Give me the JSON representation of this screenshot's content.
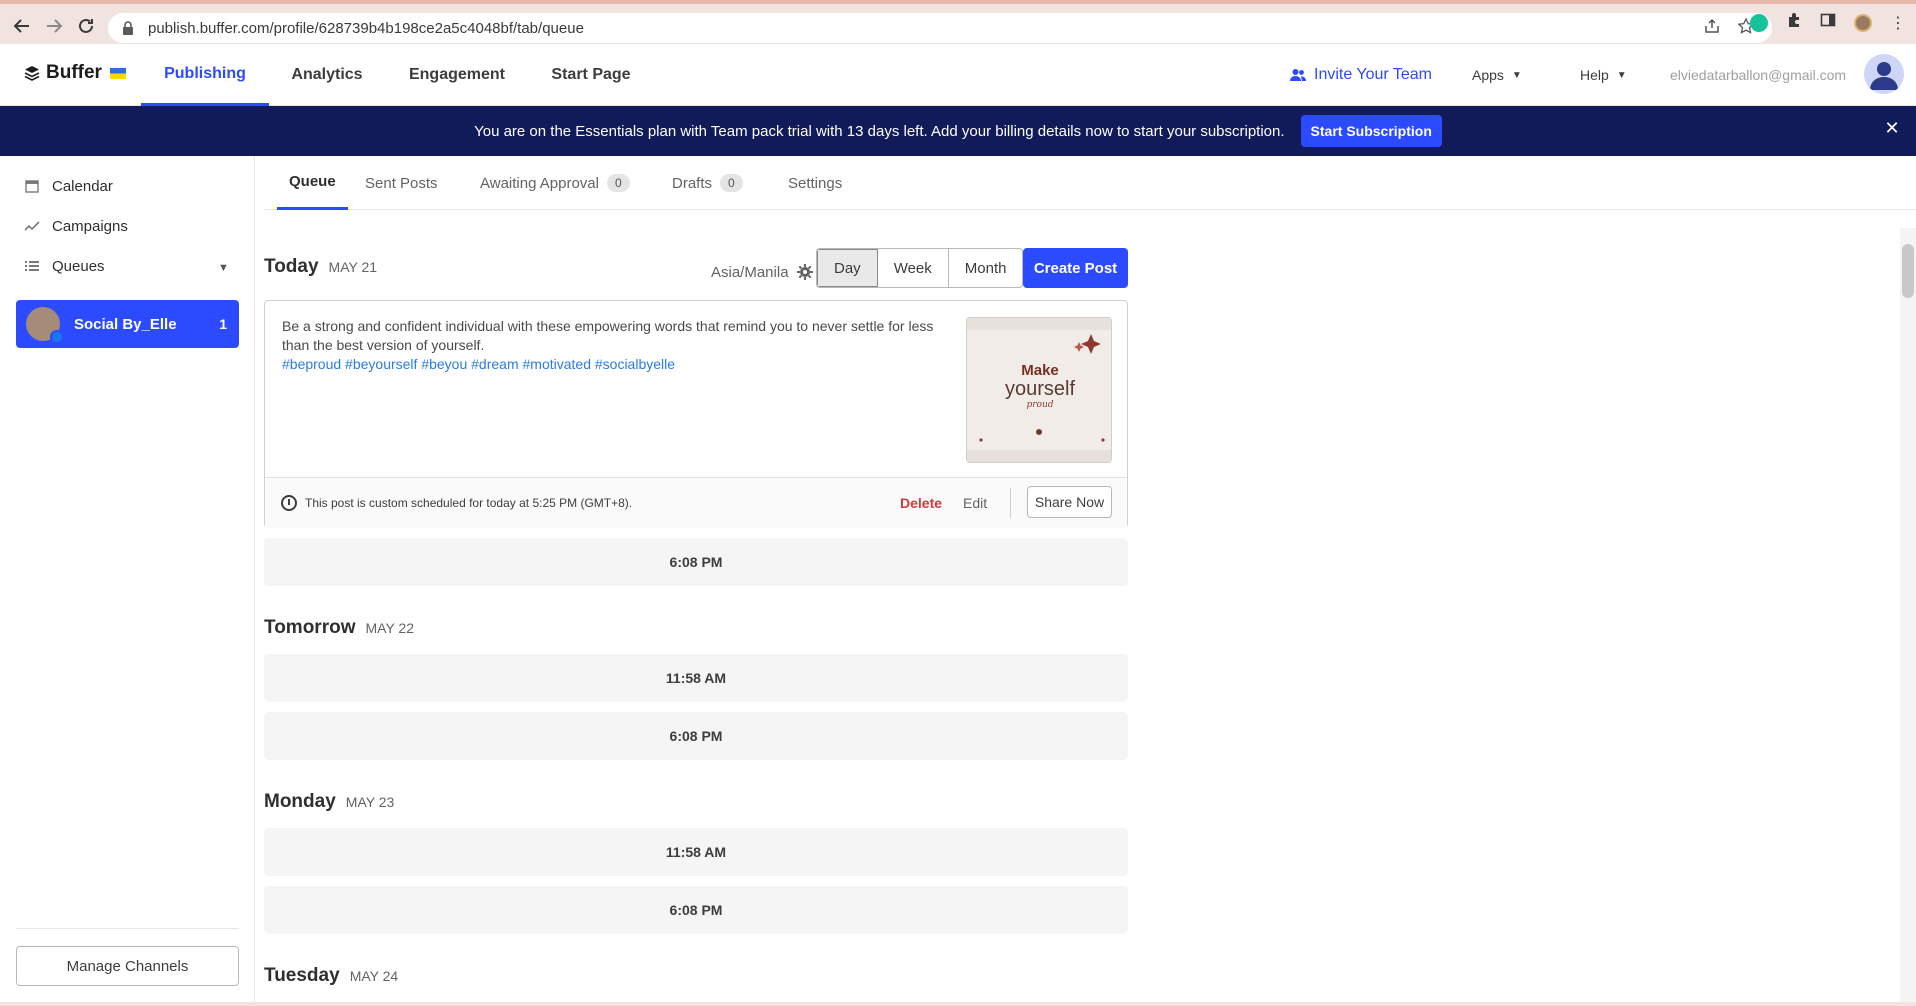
{
  "browser": {
    "url": "publish.buffer.com/profile/628739b4b198ce2a5c4048bf/tab/queue"
  },
  "header": {
    "logo": "Buffer",
    "tabs": [
      "Publishing",
      "Analytics",
      "Engagement",
      "Start Page"
    ],
    "invite": "Invite Your Team",
    "apps": "Apps",
    "help": "Help",
    "email": "elviedatarballon@gmail.com"
  },
  "banner": {
    "text": "You are on the Essentials plan with Team pack trial with 13 days left. Add your billing details now to start your subscription.",
    "button": "Start Subscription"
  },
  "sidebar": {
    "items": [
      "Calendar",
      "Campaigns",
      "Queues"
    ],
    "channel": {
      "name": "Social By_Elle",
      "count": "1"
    },
    "manage": "Manage Channels"
  },
  "subtabs": [
    {
      "label": "Queue",
      "count": ""
    },
    {
      "label": "Sent Posts",
      "count": ""
    },
    {
      "label": "Awaiting Approval",
      "count": "0"
    },
    {
      "label": "Drafts",
      "count": "0"
    },
    {
      "label": "Settings",
      "count": ""
    }
  ],
  "queue": {
    "timezone": "Asia/Manila",
    "views": [
      "Day",
      "Week",
      "Month"
    ],
    "create": "Create Post",
    "days": [
      {
        "name": "Today",
        "date": "MAY 21"
      },
      {
        "name": "Tomorrow",
        "date": "MAY 22"
      },
      {
        "name": "Monday",
        "date": "MAY 23"
      },
      {
        "name": "Tuesday",
        "date": "MAY 24"
      }
    ],
    "post": {
      "text": "Be a strong and confident individual with these empowering words that remind you to never settle for less than the best version of yourself.",
      "hashtags": "#beproud #beyourself #beyou #dream #motivated #socialbyelle",
      "image_text": [
        "Make",
        "yourself",
        "proud"
      ],
      "schedule": "This post is custom scheduled for today at 5:25 PM (GMT+8).",
      "delete": "Delete",
      "edit": "Edit",
      "share": "Share Now"
    },
    "slots": [
      "6:08 PM",
      "11:58 AM",
      "6:08 PM",
      "11:58 AM",
      "6:08 PM"
    ]
  },
  "colors": {
    "accent": "#2c4bff",
    "banner": "#121b5a",
    "delete": "#d33a3a",
    "hashtag": "#2c7be5"
  }
}
